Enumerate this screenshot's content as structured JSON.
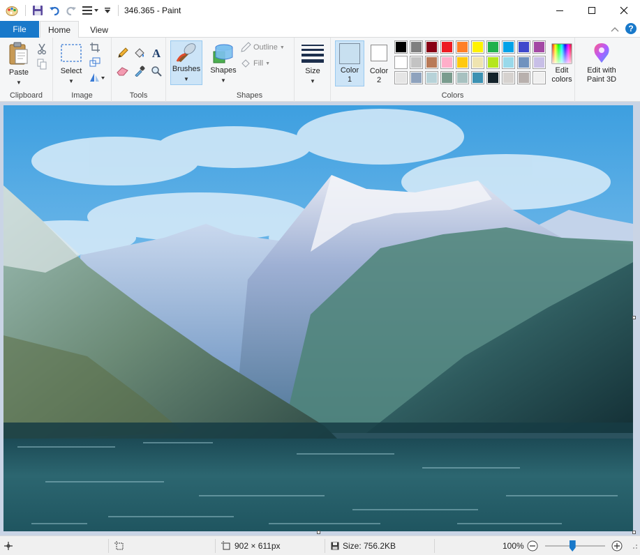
{
  "window": {
    "title": "346.365 - Paint"
  },
  "tabs": {
    "file": "File",
    "home": "Home",
    "view": "View"
  },
  "ribbon": {
    "clipboard": {
      "paste": "Paste",
      "label": "Clipboard"
    },
    "image": {
      "select": "Select",
      "label": "Image"
    },
    "tools": {
      "label": "Tools"
    },
    "brushes": "Brushes",
    "shapes": {
      "shapes": "Shapes",
      "outline": "Outline",
      "fill": "Fill",
      "label": "Shapes"
    },
    "size": "Size",
    "colors": {
      "color1_line1": "Color",
      "color1_line2": "1",
      "color2_line1": "Color",
      "color2_line2": "2",
      "edit_line1": "Edit",
      "edit_line2": "colors",
      "label": "Colors",
      "color1_value": "#c8e0f0",
      "color2_value": "#ffffff",
      "palette": [
        "#000000",
        "#7f7f7f",
        "#880015",
        "#ed1c24",
        "#ff7f27",
        "#fff200",
        "#22b14c",
        "#00a2e8",
        "#3f48cc",
        "#a349a4",
        "#ffffff",
        "#c3c3c3",
        "#b97a57",
        "#ffaec9",
        "#ffc90e",
        "#efe4b0",
        "#b5e61d",
        "#99d9ea",
        "#7092be",
        "#c8bfe7",
        "#e5e5e5",
        "#8ea2bd",
        "#b7d2d8",
        "#7a9c8e",
        "#a7c1c0",
        "#3c91b2",
        "#14232b",
        "#d6d2cf",
        "#b8b0ad",
        "#f0f0f0"
      ]
    },
    "paint3d": {
      "line1": "Edit with",
      "line2": "Paint 3D"
    }
  },
  "status": {
    "dimensions": "902 × 611px",
    "size": "Size: 756.2KB",
    "zoom": "100%",
    "zoom_level": 0.45
  }
}
